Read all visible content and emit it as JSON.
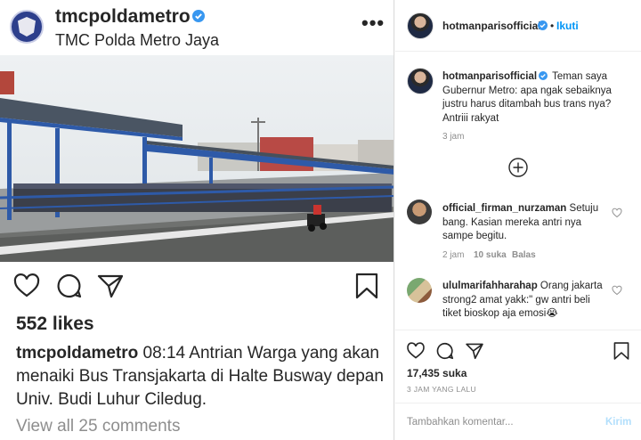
{
  "post": {
    "username": "tmcpoldametro",
    "full_name": "TMC Polda Metro Jaya",
    "more_label": "•••",
    "likes": "552 likes",
    "caption_user": "tmcpoldametro",
    "caption_text": " 08:14 Antrian Warga yang akan menaiki Bus Transjakarta di Halte Busway depan Univ. Budi Luhur Ciledug.",
    "view_all": "View all 25 comments"
  },
  "panel": {
    "header": {
      "username": "hotmanparisofficial",
      "dot": "•",
      "follow": "Ikuti"
    },
    "caption": {
      "username": "hotmanparisofficial",
      "text": " Teman saya Gubernur Metro: apa ngak sebaiknya justru harus ditambah bus trans nya? Antriii rakyat",
      "time": "3 jam"
    },
    "comments": [
      {
        "username": "official_firman_nurzaman",
        "text": " Setuju bang. Kasian mereka antri nya sampe begitu.",
        "time": "2 jam",
        "likes": "10 suka",
        "reply": "Balas"
      },
      {
        "username": "ululmarifahharahap",
        "text": " Orang jakarta strong2 amat yakk:\" gw antri beli tiket bioskop aja emosi😭",
        "time": "",
        "likes": "",
        "reply": ""
      }
    ],
    "likes": "17,435 suka",
    "time": "3 JAM YANG LALU",
    "comment_placeholder": "Tambahkan komentar...",
    "send_label": "Kirim"
  },
  "colors": {
    "verified": "#3897f0",
    "link": "#0095f6",
    "muted": "#8e8e8e"
  },
  "icons": [
    "heart-icon",
    "comment-icon",
    "share-icon",
    "bookmark-icon",
    "verified-icon",
    "add-circle-icon",
    "more-icon"
  ]
}
